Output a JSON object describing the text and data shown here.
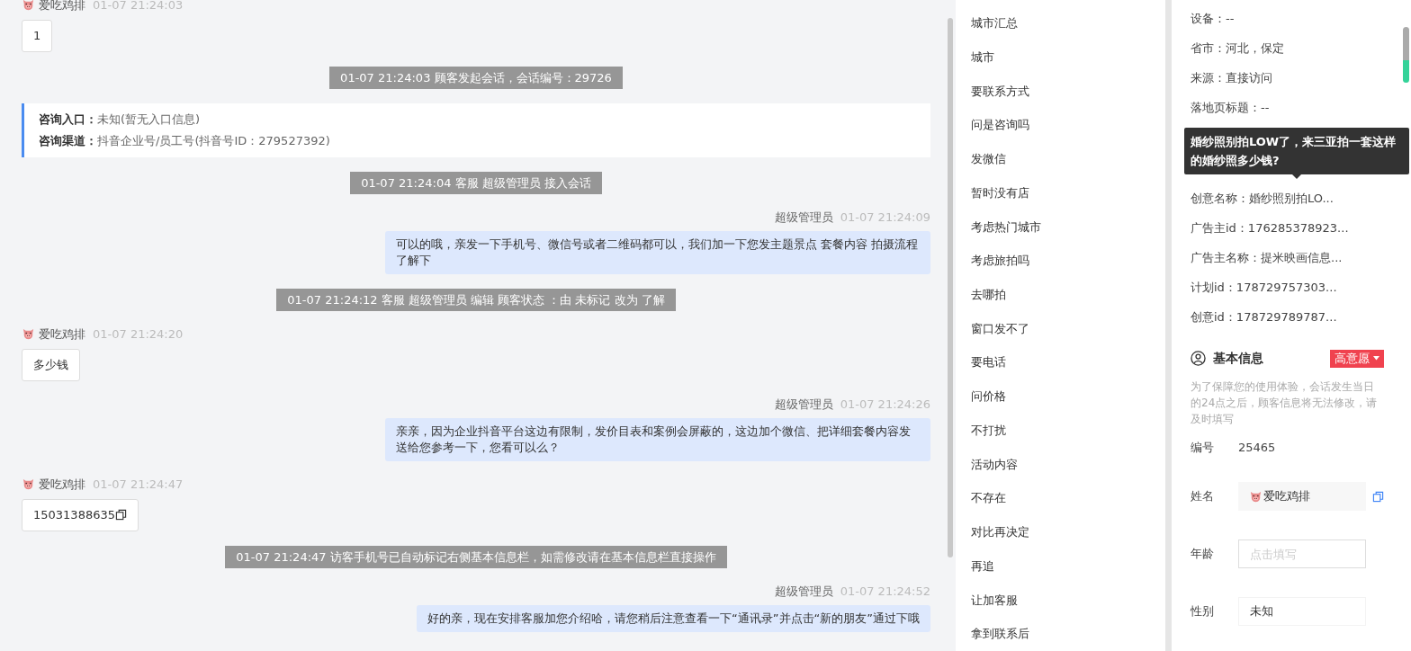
{
  "chat": {
    "messages": [
      {
        "kind": "customer",
        "name": "爱吃鸡排",
        "time": "01-07 21:24:03",
        "text": "1",
        "copyable": false
      },
      {
        "kind": "system",
        "text": "01-07 21:24:03 顾客发起会话，会话编号：29726"
      },
      {
        "kind": "info",
        "lines": [
          {
            "label": "咨询入口：",
            "value": "未知(暂无入口信息)"
          },
          {
            "label": "咨询渠道：",
            "value": "抖音企业号/员工号(抖音号ID：279527392)"
          }
        ]
      },
      {
        "kind": "system",
        "text": "01-07 21:24:04 客服 超级管理员 接入会话"
      },
      {
        "kind": "agent",
        "name": "超级管理员",
        "time": "01-07 21:24:09",
        "text": "可以的哦，亲发一下手机号、微信号或者二维码都可以，我们加一下您发主题景点 套餐内容 拍摄流程了解下"
      },
      {
        "kind": "system",
        "text": "01-07 21:24:12 客服 超级管理员 编辑 顾客状态 ：由 未标记 改为 了解"
      },
      {
        "kind": "customer",
        "name": "爱吃鸡排",
        "time": "01-07 21:24:20",
        "text": "多少钱",
        "copyable": false
      },
      {
        "kind": "agent",
        "name": "超级管理员",
        "time": "01-07 21:24:26",
        "text": "亲亲，因为企业抖音平台这边有限制，发价目表和案例会屏蔽的，这边加个微信、把详细套餐内容发送给您参考一下，您看可以么？"
      },
      {
        "kind": "customer",
        "name": "爱吃鸡排",
        "time": "01-07 21:24:47",
        "text": "15031388635",
        "copyable": true
      },
      {
        "kind": "system",
        "text": "01-07 21:24:47 访客手机号已自动标记右侧基本信息栏，如需修改请在基本信息栏直接操作"
      },
      {
        "kind": "agent",
        "name": "超级管理员",
        "time": "01-07 21:24:52",
        "text": "好的亲，现在安排客服加您介绍哈，请您稍后注意查看一下“通讯录”并点击“新的朋友”通过下哦"
      }
    ]
  },
  "quick_replies": [
    "城市汇总",
    "城市",
    "要联系方式",
    "问是咨询吗",
    "发微信",
    "暂时没有店",
    "考虑热门城市",
    "考虑旅拍吗",
    "去哪拍",
    "窗口发不了",
    "要电话",
    "问价格",
    "不打扰",
    "活动内容",
    "不存在",
    "对比再决定",
    "再追",
    "让加客服",
    "拿到联系后"
  ],
  "source_info_top": [
    "设备：--",
    "省市：河北，保定",
    "来源：直接访问",
    "落地页标题：--"
  ],
  "source_info_bottom": [
    "创意名称：婚纱照别拍LO...",
    "广告主id：176285378923...",
    "广告主名称：提米映画信息...",
    "计划id：178729757303...",
    "创意id：178729789787..."
  ],
  "tooltip": "婚纱照别拍LOW了，来三亚拍一套这样的婚纱照多少钱?",
  "basic_info": {
    "title": "基本信息",
    "intent_tag": "高意愿",
    "notice": "为了保障您的使用体验，会话发生当日的24点之后，顾客信息将无法修改，请及时填写",
    "fields": [
      {
        "kind": "text",
        "label": "编号",
        "value": "25465"
      },
      {
        "kind": "name",
        "label": "姓名",
        "value": "爱吃鸡排"
      },
      {
        "kind": "input",
        "label": "年龄",
        "placeholder": "点击填写"
      },
      {
        "kind": "select",
        "label": "性别",
        "value": "未知"
      }
    ]
  }
}
